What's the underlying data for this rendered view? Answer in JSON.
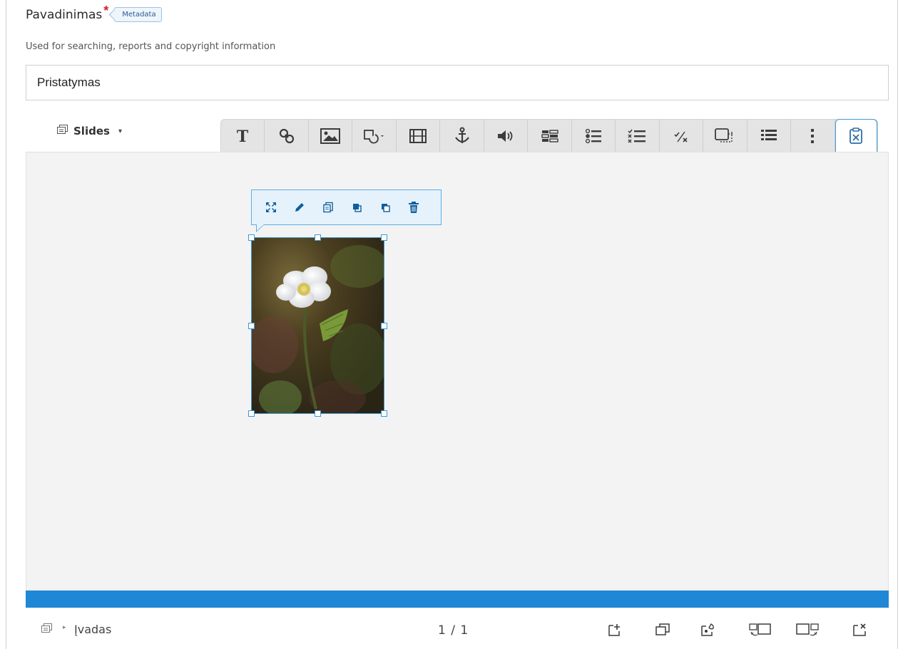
{
  "field": {
    "label": "Pavadinimas",
    "required_mark": "*",
    "badge": "Metadata",
    "description": "Used for searching, reports and copyright information",
    "value": "Pristatymas"
  },
  "slides_menu": {
    "label": "Slides",
    "caret": "▾"
  },
  "toolbar": {
    "items": [
      "text-icon",
      "link-icon",
      "image-icon",
      "shapes-icon",
      "video-icon",
      "anchor-icon",
      "audio-icon",
      "table-icon",
      "single-choice-icon",
      "multi-choice-icon",
      "true-false-icon",
      "dialog-cards-icon",
      "summary-icon",
      "more-icon",
      "paste-icon"
    ]
  },
  "element_toolbar": {
    "items": [
      "fullscreen-icon",
      "edit-icon",
      "copy-icon",
      "bring-to-front-icon",
      "send-to-back-icon",
      "delete-icon"
    ]
  },
  "footer": {
    "separator": "▸",
    "slide_name": "Įvadas",
    "page_counter": "1 / 1"
  },
  "colors": {
    "accent": "#1e88d6",
    "selection": "#3d9ad6",
    "required": "#d0232b"
  }
}
